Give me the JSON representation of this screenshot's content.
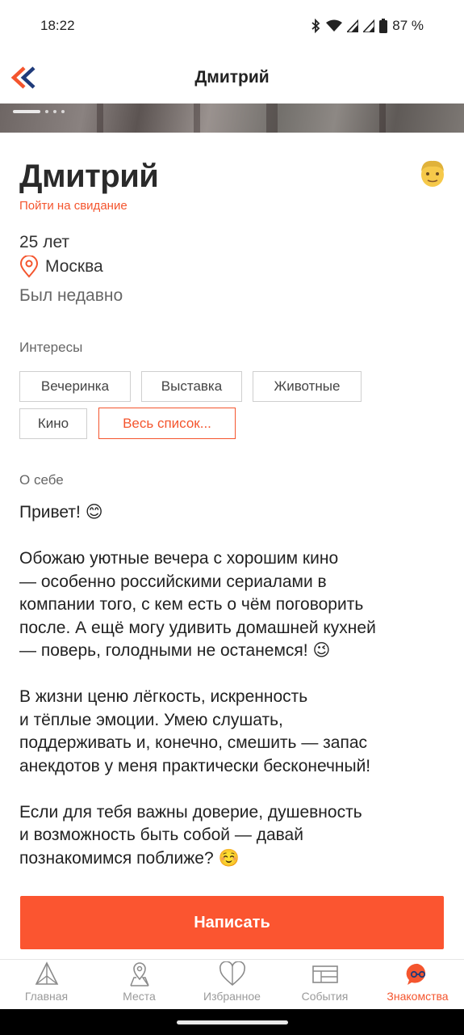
{
  "status_bar": {
    "time": "18:22",
    "battery": "87 %"
  },
  "header": {
    "title": "Дмитрий",
    "back_icon": "double-chevron-left-icon"
  },
  "profile": {
    "name": "Дмитрий",
    "date_link": "Пойти на свидание",
    "age": "25 лет",
    "city": "Москва",
    "last_seen": "Был недавно",
    "avatar_icon": "man-face-emoji"
  },
  "interests": {
    "label": "Интересы",
    "chips": [
      "Вечеринка",
      "Выставка",
      "Животные",
      "Кино"
    ],
    "all_label": "Весь список..."
  },
  "about": {
    "label": "О себе",
    "paragraphs": [
      [
        "Привет! 😊"
      ],
      [
        "Обожаю уютные вечера с хорошим кино",
        "— особенно российскими сериалами в",
        "компании того, с кем есть о чём поговорить",
        "после. А ещё могу удивить домашней кухней",
        "— поверь, голодными не останемся! 😉"
      ],
      [
        "В жизни ценю лёгкость, искренность",
        "и тёплые эмоции. Умею слушать,",
        "поддерживать и, конечно, смешить — запас",
        "анекдотов у меня практически бесконечный!"
      ],
      [
        "Если для тебя важны доверие, душевность",
        "и возможность быть собой — давай",
        "познакомимся поближе? ☺️"
      ]
    ]
  },
  "actions": {
    "write_label": "Написать"
  },
  "bottom_nav": {
    "items": [
      {
        "label": "Главная",
        "icon": "home-icon"
      },
      {
        "label": "Места",
        "icon": "map-pin-icon"
      },
      {
        "label": "Избранное",
        "icon": "heart-icon"
      },
      {
        "label": "События",
        "icon": "events-icon"
      },
      {
        "label": "Знакомства",
        "icon": "dating-icon"
      }
    ],
    "active_index": 4
  },
  "colors": {
    "accent": "#f4552e",
    "button": "#fb5530"
  }
}
